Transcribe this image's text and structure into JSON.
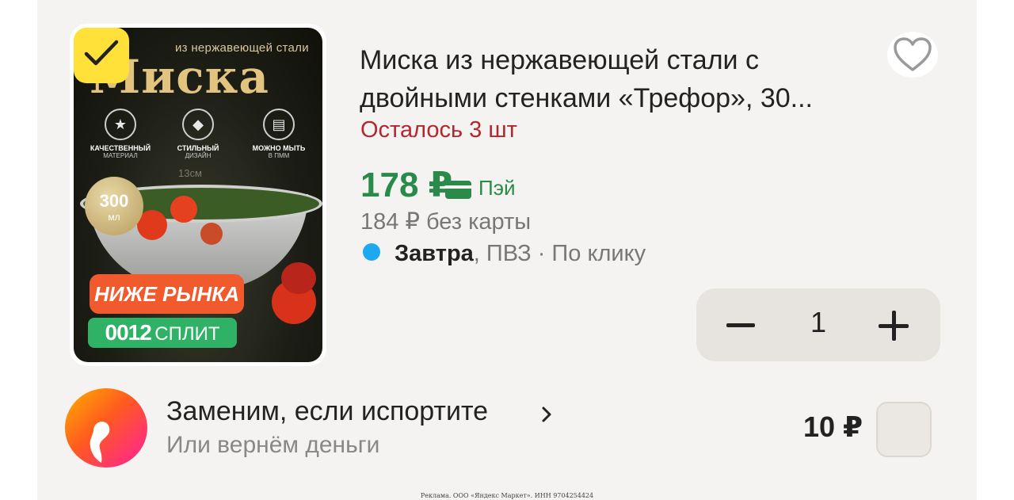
{
  "product": {
    "image": {
      "subtitle": "из нержавеющей стали",
      "title": "Миска",
      "features": [
        {
          "icon": "thumbs-up-icon",
          "title": "КАЧЕСТВЕННЫЙ",
          "sub": "МАТЕРИАЛ"
        },
        {
          "icon": "diamond-icon",
          "title": "СТИЛЬНЫЙ",
          "sub": "ДИЗАЙН"
        },
        {
          "icon": "dishwasher-icon",
          "title": "МОЖНО МЫТЬ",
          "sub": "В ПММ"
        }
      ],
      "dimension": "13см",
      "medal_value": "300",
      "medal_unit": "мл",
      "badge_market": "НИЖЕ РЫНКА",
      "badge_split_number": "0012",
      "badge_split_label": "СПЛИТ"
    },
    "title": "Миска из нержавеющей стали с двойными стенками «Трефор», 30...",
    "stock": "Осталось 3 шт",
    "price": "178 ₽",
    "pay_label": "Пэй",
    "price_without_card": "184 ₽ без карты",
    "delivery_bold": "Завтра",
    "delivery_rest": ", ПВЗ · По клику",
    "quantity": "1",
    "checked": true,
    "favorite_icon": "heart-icon"
  },
  "addon": {
    "title": "Заменим, если испортите",
    "subtitle": "Или вернём деньги",
    "price": "10 ₽"
  },
  "footer": "Реклама. ООО «Яндекс Маркет». ИНН 9704254424",
  "colors": {
    "accent_green": "#2a8a49",
    "stock_red": "#b3272e",
    "check_yellow": "#ffe13a",
    "delivery_dot": "#1ea8f0"
  }
}
